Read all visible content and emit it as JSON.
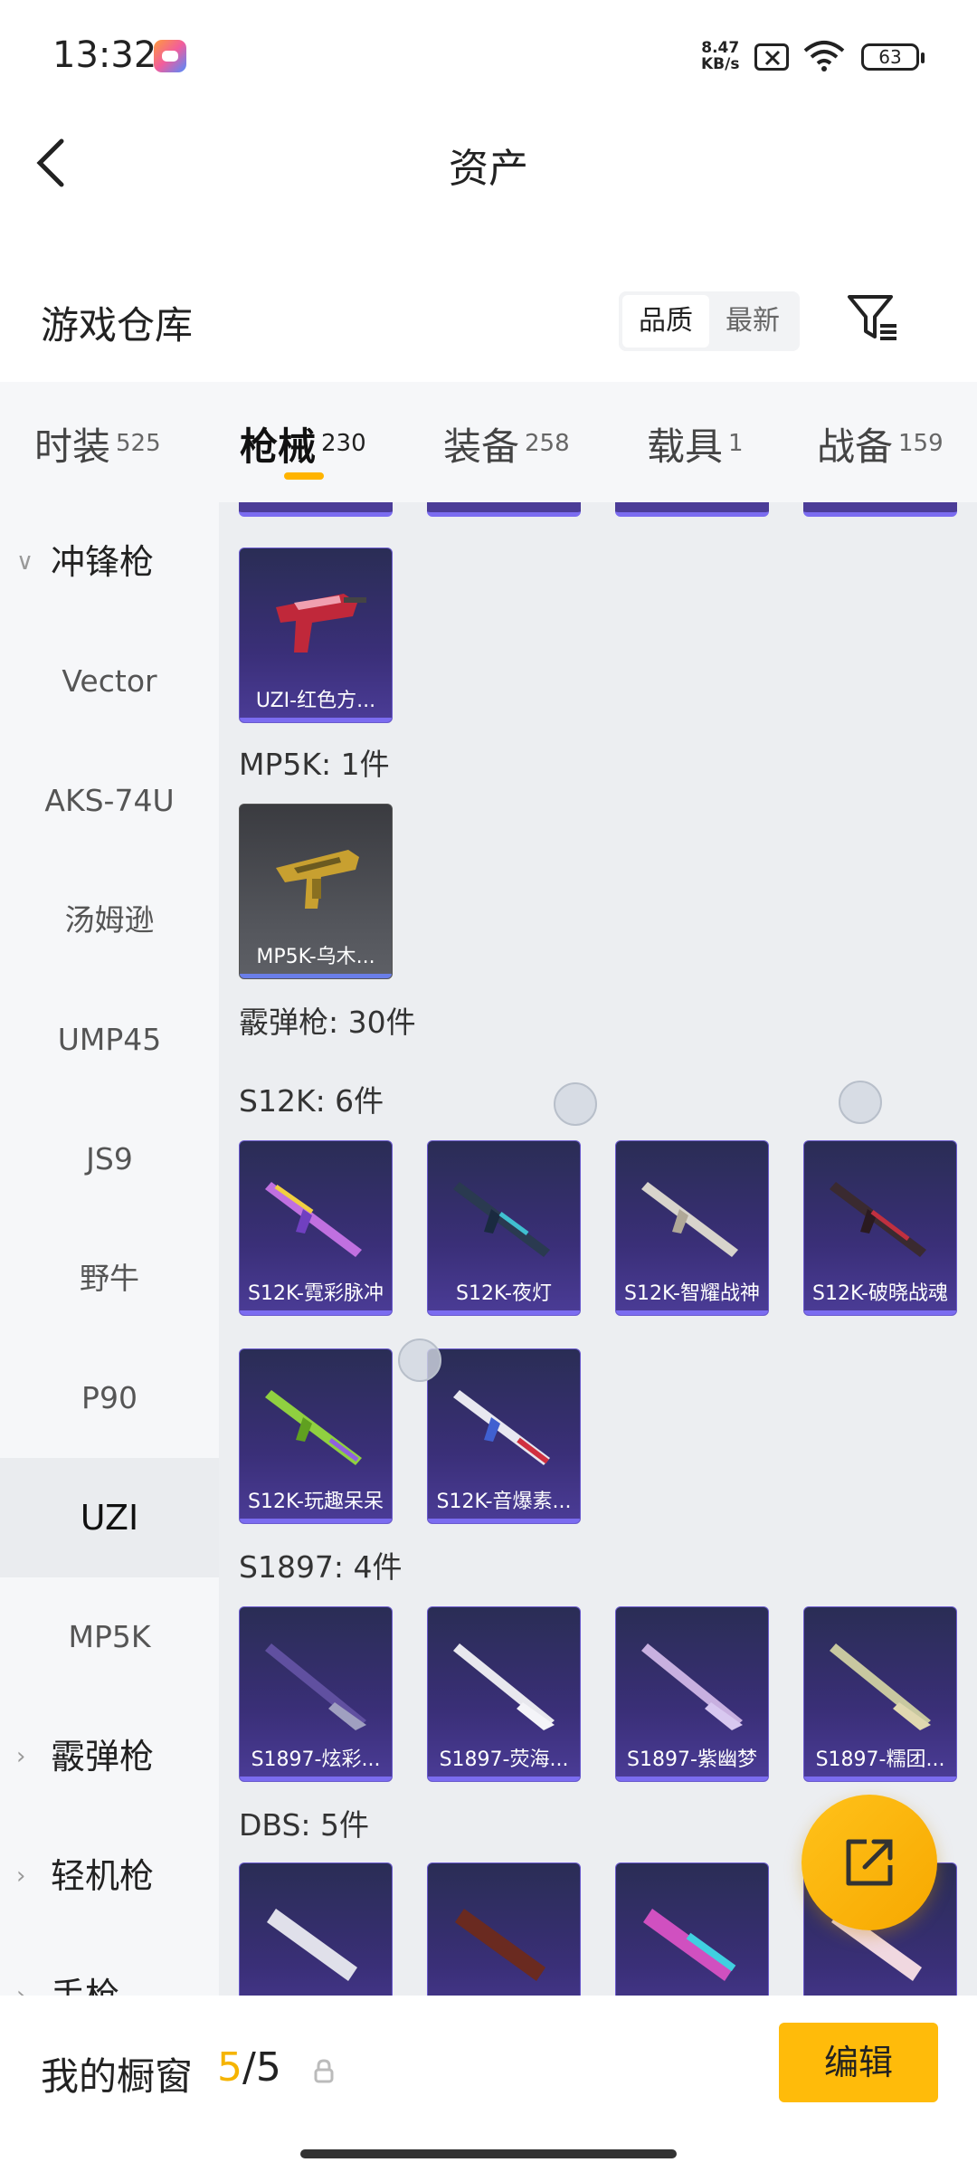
{
  "status_bar": {
    "time": "13:32",
    "net_speed_value": "8.47",
    "net_speed_unit": "KB/s",
    "battery": "63"
  },
  "header": {
    "title": "资产"
  },
  "warehouse": {
    "title": "游戏仓库",
    "sort_options": [
      "品质",
      "最新"
    ],
    "selected_sort": "品质"
  },
  "tabs": [
    {
      "label": "时装",
      "count": "525"
    },
    {
      "label": "枪械",
      "count": "230",
      "active": true
    },
    {
      "label": "装备",
      "count": "258"
    },
    {
      "label": "载具",
      "count": "1"
    },
    {
      "label": "战备",
      "count": "159"
    }
  ],
  "sidebar": {
    "group_smg": "冲锋枪",
    "items": [
      "Vector",
      "AKS-74U",
      "汤姆逊",
      "UMP45",
      "JS9",
      "野牛",
      "P90",
      "UZI",
      "MP5K"
    ],
    "active_item": "UZI",
    "group_shotgun": "霰弹枪",
    "group_lmg": "轻机枪",
    "group_pistol": "手枪"
  },
  "content": {
    "uzi_items": [
      "UZI-红色方..."
    ],
    "mp5k_label": "MP5K: 1件",
    "mp5k_items": [
      "MP5K-乌木..."
    ],
    "shotgun_label": "霰弹枪: 30件",
    "s12k_label": "S12K: 6件",
    "s12k_items": [
      "S12K-霓彩脉冲",
      "S12K-夜灯",
      "S12K-智耀战神",
      "S12K-破晓战魂",
      "S12K-玩趣呆呆",
      "S12K-音爆素..."
    ],
    "s1897_label": "S1897: 4件",
    "s1897_items": [
      "S1897-炫彩...",
      "S1897-荧海...",
      "S1897-紫幽梦",
      "S1897-糯团..."
    ],
    "dbs_label": "DBS: 5件"
  },
  "bottom_bar": {
    "label": "我的橱窗",
    "showcase_current": "5",
    "showcase_total": "/5",
    "edit_label": "编辑"
  },
  "colors": {
    "accent": "#ffb400",
    "card_purple": "#3a2f78",
    "card_border": "#7b6cf0"
  },
  "icons": [
    "back-arrow-icon",
    "filter-icon",
    "lock-icon",
    "share-icon",
    "wifi-icon",
    "battery-icon"
  ]
}
